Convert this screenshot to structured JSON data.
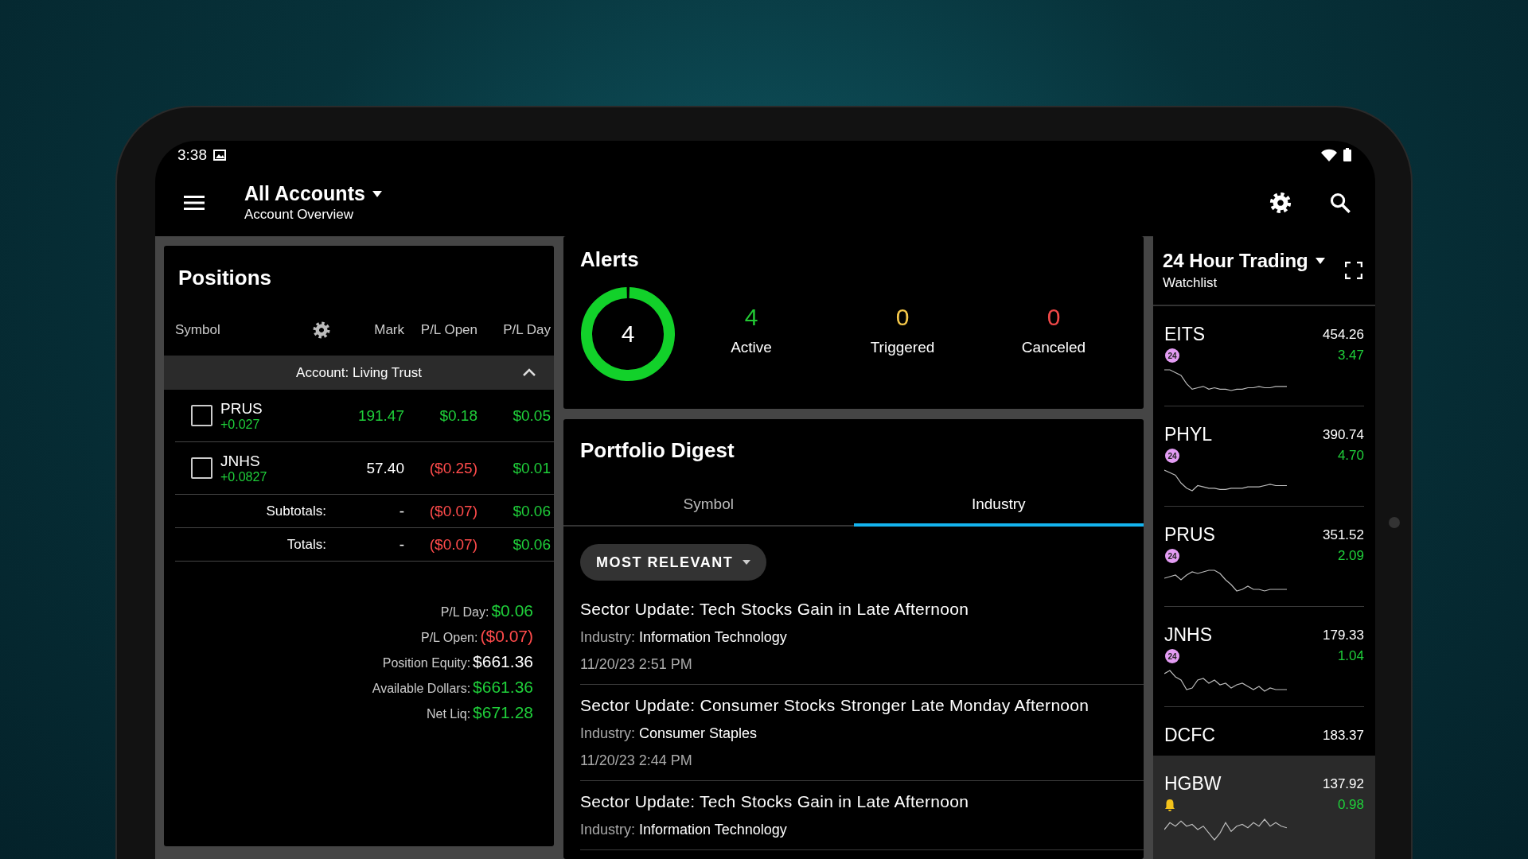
{
  "status_bar": {
    "time": "3:38"
  },
  "app_bar": {
    "title": "All Accounts",
    "subtitle": "Account Overview"
  },
  "positions": {
    "title": "Positions",
    "columns": [
      "Symbol",
      "Mark",
      "P/L Open",
      "P/L Day"
    ],
    "group": {
      "label": "Account: Living Trust",
      "expanded": true
    },
    "rows": [
      {
        "symbol": "PRUS",
        "checked": false,
        "change": {
          "text": "+0.027",
          "color": "#1fcf3a"
        },
        "mark": {
          "text": "191.47",
          "color": "#1fcf3a"
        },
        "pl_open": {
          "text": "$0.18",
          "color": "#1fcf3a"
        },
        "pl_day": {
          "text": "$0.05",
          "color": "#1fcf3a"
        }
      },
      {
        "symbol": "JNHS",
        "checked": false,
        "change": {
          "text": "+0.0827",
          "color": "#1fcf3a"
        },
        "mark": {
          "text": "57.40",
          "color": "#ffffff"
        },
        "pl_open": {
          "text": "($0.25)",
          "color": "#ff4b4b"
        },
        "pl_day": {
          "text": "$0.01",
          "color": "#1fcf3a"
        }
      }
    ],
    "totals": [
      {
        "label": "Subtotals:",
        "mark": {
          "text": "-",
          "color": "#ffffff"
        },
        "pl_open": {
          "text": "($0.07)",
          "color": "#ff4b4b"
        },
        "pl_day": {
          "text": "$0.06",
          "color": "#1fcf3a"
        }
      },
      {
        "label": "Totals:",
        "mark": {
          "text": "-",
          "color": "#ffffff"
        },
        "pl_open": {
          "text": "($0.07)",
          "color": "#ff4b4b"
        },
        "pl_day": {
          "text": "$0.06",
          "color": "#1fcf3a"
        }
      }
    ],
    "summary": [
      {
        "label": "P/L Day:",
        "value": "$0.06",
        "color": "#1fcf3a"
      },
      {
        "label": "P/L Open:",
        "value": "($0.07)",
        "color": "#ff4b4b"
      },
      {
        "label": "Position Equity:",
        "value": "$661.36",
        "color": "#ffffff"
      },
      {
        "label": "Available Dollars:",
        "value": "$661.36",
        "color": "#1fcf3a"
      },
      {
        "label": "Net Liq:",
        "value": "$671.28",
        "color": "#1fcf3a"
      }
    ]
  },
  "alerts": {
    "title": "Alerts",
    "total": "4",
    "stats": [
      {
        "value": "4",
        "label": "Active",
        "color": "#22c833"
      },
      {
        "value": "0",
        "label": "Triggered",
        "color": "#f5c84a"
      },
      {
        "value": "0",
        "label": "Canceled",
        "color": "#f04848"
      }
    ]
  },
  "portfolio_digest": {
    "title": "Portfolio Digest",
    "tabs": [
      {
        "label": "Symbol",
        "selected": false
      },
      {
        "label": "Industry",
        "selected": true
      }
    ],
    "filter": "MOST RELEVANT",
    "news": [
      {
        "title": "Sector Update: Tech Stocks Gain in Late Afternoon",
        "industry_label": "Industry:",
        "industry": "Information Technology",
        "time": "11/20/23 2:51 PM"
      },
      {
        "title": "Sector Update: Consumer Stocks Stronger Late Monday Afternoon",
        "industry_label": "Industry:",
        "industry": "Consumer Staples",
        "time": "11/20/23 2:44 PM"
      },
      {
        "title": "Sector Update: Tech Stocks Gain in Late Afternoon",
        "industry_label": "Industry:",
        "industry": "Information Technology"
      }
    ]
  },
  "watchlist": {
    "title": "24 Hour Trading",
    "subtitle": "Watchlist",
    "items": [
      {
        "symbol": "EITS",
        "price": "454.26",
        "change": "3.47",
        "color": "#1fcf3a",
        "badge": "24",
        "alert": false,
        "selected": false
      },
      {
        "symbol": "PHYL",
        "price": "390.74",
        "change": "4.70",
        "color": "#1fcf3a",
        "badge": "24",
        "alert": false,
        "selected": false
      },
      {
        "symbol": "PRUS",
        "price": "351.52",
        "change": "2.09",
        "color": "#1fcf3a",
        "badge": "24",
        "alert": false,
        "selected": false
      },
      {
        "symbol": "JNHS",
        "price": "179.33",
        "change": "1.04",
        "color": "#1fcf3a",
        "badge": "24",
        "alert": false,
        "selected": false
      },
      {
        "symbol": "DCFC",
        "price": "183.37",
        "alert": false,
        "selected": false
      },
      {
        "symbol": "HGBW",
        "price": "137.92",
        "change": "0.98",
        "color": "#1fcf3a",
        "alert": true,
        "selected": true
      }
    ]
  }
}
